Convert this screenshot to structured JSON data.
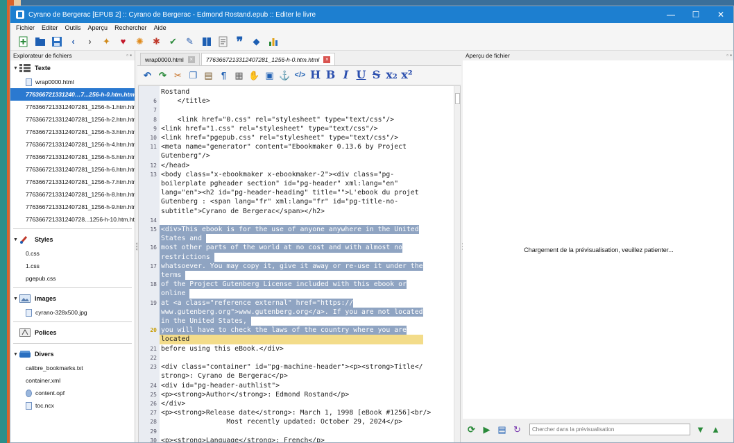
{
  "window": {
    "title": "Cyrano de Bergerac [EPUB 2] :: Cyrano de Bergerac - Edmond Rostand.epub :: Editer le livre",
    "minimize": "—",
    "maximize": "☐",
    "close": "✕"
  },
  "menu": [
    "Fichier",
    "Editer",
    "Outils",
    "Aperçu",
    "Rechercher",
    "Aide"
  ],
  "left_pane": {
    "header": "Explorateur de fichiers",
    "sections": {
      "texte": "Texte",
      "styles": "Styles",
      "images": "Images",
      "polices": "Polices",
      "divers": "Divers"
    },
    "texte_files": [
      "wrap0000.html",
      "776366721331240…7...256-h-0.htm.html",
      "7763667213312407281_1256-h-1.htm.html",
      "7763667213312407281_1256-h-2.htm.html",
      "7763667213312407281_1256-h-3.htm.html",
      "7763667213312407281_1256-h-4.htm.html",
      "7763667213312407281_1256-h-5.htm.html",
      "7763667213312407281_1256-h-6.htm.html",
      "7763667213312407281_1256-h-7.htm.html",
      "7763667213312407281_1256-h-8.htm.html",
      "7763667213312407281_1256-h-9.htm.html",
      "776366721331240728...1256-h-10.htm.html"
    ],
    "styles_files": [
      "0.css",
      "1.css",
      "pgepub.css"
    ],
    "images_files": [
      "cyrano-328x500.jpg"
    ],
    "divers_files": [
      "calibre_bookmarks.txt",
      "container.xml",
      "content.opf",
      "toc.ncx"
    ]
  },
  "editor": {
    "tabs": [
      "wrap0000.html",
      "7763667213312407281_1256-h-0.htm.html"
    ],
    "lines": [
      {
        "n": "",
        "t": "Rostand"
      },
      {
        "n": "6",
        "t": "    </title>"
      },
      {
        "n": "7",
        "t": ""
      },
      {
        "n": "8",
        "t": "    <link href=\"0.css\" rel=\"stylesheet\" type=\"text/css\"/>"
      },
      {
        "n": "9",
        "t": "<link href=\"1.css\" rel=\"stylesheet\" type=\"text/css\"/>"
      },
      {
        "n": "10",
        "t": "<link href=\"pgepub.css\" rel=\"stylesheet\" type=\"text/css\"/>"
      },
      {
        "n": "11",
        "t": "<meta name=\"generator\" content=\"Ebookmaker 0.13.6 by Project"
      },
      {
        "n": "",
        "t": "Gutenberg\"/>"
      },
      {
        "n": "12",
        "t": "</head>"
      },
      {
        "n": "13",
        "t": "<body class=\"x-ebookmaker x-ebookmaker-2\"><div class=\"pg-"
      },
      {
        "n": "",
        "t": "boilerplate pgheader section\" id=\"pg-header\" xml:lang=\"en\""
      },
      {
        "n": "",
        "t": "lang=\"en\"><h2 id=\"pg-header-heading\" title=\"\">L'ebook du projet"
      },
      {
        "n": "",
        "t": "Gutenberg : <span lang=\"fr\" xml:lang=\"fr\" id=\"pg-title-no-"
      },
      {
        "n": "",
        "t": "subtitle\">Cyrano de Bergerac</span></h2>"
      },
      {
        "n": "14",
        "t": ""
      },
      {
        "n": "15",
        "t": "<div>This ebook is for the use of anyone anywhere in the United",
        "s": "sel"
      },
      {
        "n": "",
        "t": "States and ",
        "s": "sel"
      },
      {
        "n": "16",
        "t": "most other parts of the world at no cost and with almost no",
        "s": "sel"
      },
      {
        "n": "",
        "t": "restrictions ",
        "s": "sel"
      },
      {
        "n": "17",
        "t": "whatsoever. You may copy it, give it away or re-use it under the",
        "s": "sel"
      },
      {
        "n": "",
        "t": "terms ",
        "s": "sel"
      },
      {
        "n": "18",
        "t": "of the Project Gutenberg License included with this ebook or",
        "s": "sel"
      },
      {
        "n": "",
        "t": "online ",
        "s": "sel"
      },
      {
        "n": "19",
        "t": "at <a class=\"reference external\" href=\"https://",
        "s": "sel"
      },
      {
        "n": "",
        "t": "www.gutenberg.org\">www.gutenberg.org</a>. If you are not located",
        "s": "sel"
      },
      {
        "n": "",
        "t": "in the United States, ",
        "s": "sel"
      },
      {
        "n": "20",
        "t": "you will have to check the laws of the country where you are",
        "s": "sel",
        "cur": true
      },
      {
        "n": "",
        "t": "located                                                         ",
        "s": "hl"
      },
      {
        "n": "21",
        "t": "before using this eBook.</div>"
      },
      {
        "n": "22",
        "t": ""
      },
      {
        "n": "23",
        "t": "<div class=\"container\" id=\"pg-machine-header\"><p><strong>Title</"
      },
      {
        "n": "",
        "t": "strong>: Cyrano de Bergerac</p>"
      },
      {
        "n": "24",
        "t": "<div id=\"pg-header-authlist\">"
      },
      {
        "n": "25",
        "t": "<p><strong>Author</strong>: Edmond Rostand</p>"
      },
      {
        "n": "26",
        "t": "</div>"
      },
      {
        "n": "27",
        "t": "<p><strong>Release date</strong>: March 1, 1998 [eBook #1256]<br/>"
      },
      {
        "n": "28",
        "t": "                Most recently updated: October 29, 2024</p>"
      },
      {
        "n": "29",
        "t": ""
      },
      {
        "n": "30",
        "t": "<p><strong>Language</strong>: French</p>"
      }
    ]
  },
  "preview": {
    "header": "Aperçu de fichier",
    "loading": "Chargement de la prévisualisation, veuillez patienter...",
    "search_placeholder": "Chercher dans la prévisualisation"
  },
  "colors": {
    "titlebar": "#1d7fd0",
    "selection": "#2b79d0",
    "code_selection": "#8fa4c2",
    "current_line": "#f3dc8a"
  }
}
